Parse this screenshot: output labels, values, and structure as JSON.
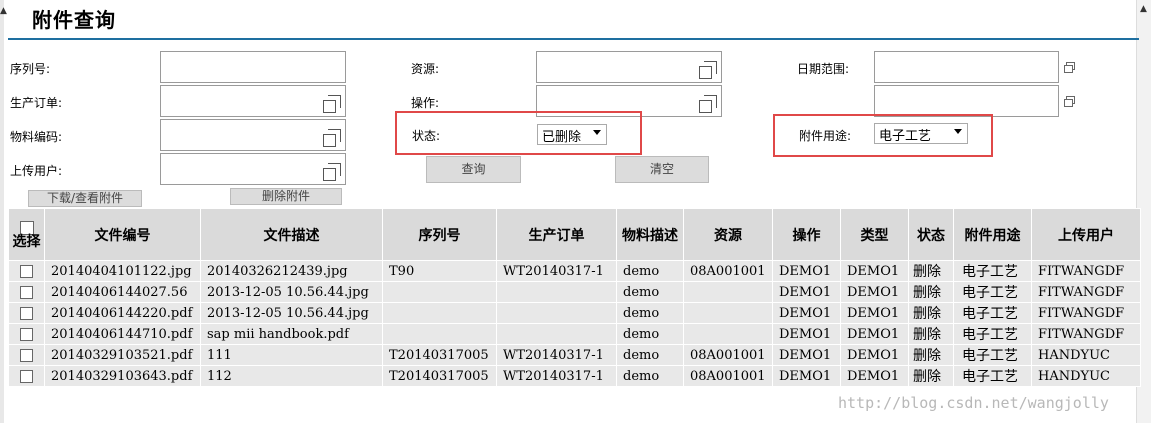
{
  "page_title": "附件查询",
  "form": {
    "serial_label": "序列号:",
    "order_label": "生产订单:",
    "material_label": "物料编码:",
    "upload_user_label": "上传用户:",
    "resource_label": "资源:",
    "operation_label": "操作:",
    "status_label": "状态:",
    "status_value": "已删除",
    "date_range_label": "日期范围:",
    "usage_label": "附件用途:",
    "usage_value": "电子工艺"
  },
  "buttons": {
    "query": "查询",
    "clear": "清空",
    "download": "下载/查看附件",
    "delete": "删除附件"
  },
  "table": {
    "select_header": "选择",
    "headers": [
      "文件编号",
      "文件描述",
      "序列号",
      "生产订单",
      "物料描述",
      "资源",
      "操作",
      "类型",
      "状态",
      "附件用途",
      "上传用户"
    ],
    "rows": [
      [
        "20140404101122.jpg",
        "20140326212439.jpg",
        "T90",
        "WT20140317-1",
        "demo",
        "08A001001",
        "DEMO1",
        "DEMO1",
        "删除",
        "电子工艺",
        "FITWANGDF"
      ],
      [
        "20140406144027.56",
        "2013-12-05 10.56.44.jpg",
        "",
        "",
        "demo",
        "",
        "DEMO1",
        "DEMO1",
        "删除",
        "电子工艺",
        "FITWANGDF"
      ],
      [
        "20140406144220.pdf",
        "2013-12-05 10.56.44.jpg",
        "",
        "",
        "demo",
        "",
        "DEMO1",
        "DEMO1",
        "删除",
        "电子工艺",
        "FITWANGDF"
      ],
      [
        "20140406144710.pdf",
        "sap mii handbook.pdf",
        "",
        "",
        "demo",
        "",
        "DEMO1",
        "DEMO1",
        "删除",
        "电子工艺",
        "FITWANGDF"
      ],
      [
        "20140329103521.pdf",
        "111",
        "T20140317005",
        "WT20140317-1",
        "demo",
        "08A001001",
        "DEMO1",
        "DEMO1",
        "删除",
        "电子工艺",
        "HANDYUC"
      ],
      [
        "20140329103643.pdf",
        "112",
        "T20140317005",
        "WT20140317-1",
        "demo",
        "08A001001",
        "DEMO1",
        "DEMO1",
        "删除",
        "电子工艺",
        "HANDYUC"
      ]
    ]
  },
  "watermark": "http://blog.csdn.net/wangjolly"
}
